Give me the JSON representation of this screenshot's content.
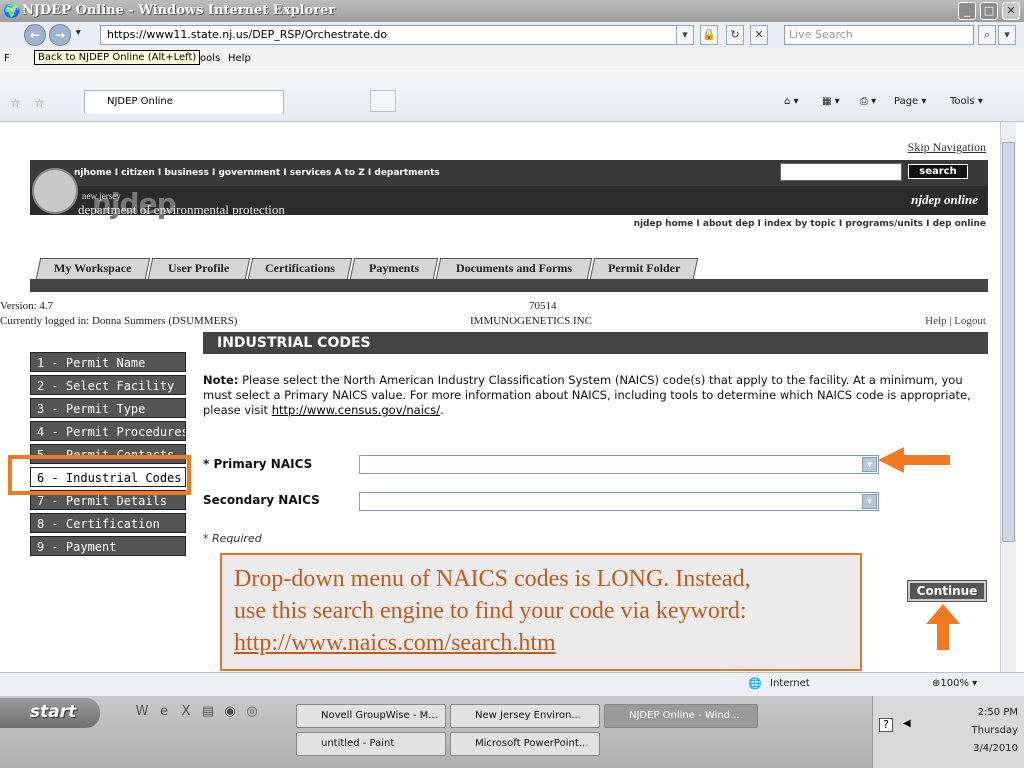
{
  "window": {
    "title": "NJDEP Online - Windows Internet Explorer",
    "controls": [
      "_",
      "□",
      "✕"
    ]
  },
  "address": {
    "url": "https://www11.state.nj.us/DEP_RSP/Orchestrate.do",
    "search_placeholder": "Live Search"
  },
  "menu": {
    "items": [
      "F",
      "ools",
      "Help"
    ],
    "tooltip": "Back to NJDEP Online (Alt+Left)"
  },
  "ie_tab": {
    "label": "NJDEP Online",
    "page_label": "Page ▾",
    "tools_label": "Tools ▾"
  },
  "site": {
    "skip_nav": "Skip Navigation",
    "top_links": "njhome  I  citizen  I  business  I  government  I  services A to Z  I  departments",
    "search_button": "search",
    "new_jersey": "new jersey",
    "nj_wordmark": "njdep",
    "department": "department of environmental protection",
    "online_logo": "njdep online",
    "sub_links": "njdep home  I  about dep  I  index by topic  I  programs/units  I  dep online"
  },
  "main_tabs": [
    "My Workspace",
    "User Profile",
    "Certifications",
    "Payments",
    "Documents and Forms",
    "Permit Folder"
  ],
  "info": {
    "version": "Version: 4.7",
    "logged_in": "Currently logged in: Donna Summers (DSUMMERS)",
    "facility_id": "70514",
    "facility_name": "IMMUNOGENETICS INC",
    "help_logout": "Help | Logout"
  },
  "sidenav": [
    "1 - Permit Name",
    "2 - Select Facility",
    "3 - Permit Type",
    "4 - Permit Procedures",
    "5 - Permit Contacts",
    "6 - Industrial Codes",
    "7 - Permit Details",
    "8 - Certification",
    "9 - Payment"
  ],
  "form": {
    "heading": "INDUSTRIAL CODES",
    "note_label": "Note:",
    "note_text": " Please select the North American Industry Classification System (NAICS) code(s) that apply to the facility. At a minimum, you must select a Primary NAICS value. For more information about NAICS, including tools to determine which NAICS code is appropriate, please visit ",
    "note_link": "http://www.census.gov/naics/",
    "note_end": ".",
    "primary_label": "* Primary NAICS",
    "secondary_label": "Secondary NAICS",
    "required_note": "* Required",
    "continue": "Continue"
  },
  "callout": {
    "line1": "Drop-down menu of NAICS codes is LONG.  Instead,",
    "line2": "use this search engine to find your code via keyword:",
    "link": "http://www.naics.com/search.htm"
  },
  "status": {
    "zone": "Internet",
    "zoom": "⊕100%  ▾"
  },
  "taskbar": {
    "start": "start",
    "buttons": [
      "Novell GroupWise - M...",
      "New Jersey Environ...",
      "NJDEP Online - Wind...",
      "untitled - Paint",
      "Microsoft PowerPoint..."
    ],
    "time": "2:50 PM",
    "day": "Thursday",
    "date": "3/4/2010"
  },
  "colors": {
    "annotation_orange": "#e8752a",
    "callout_text": "#c25a1e",
    "header_dark": "#444444"
  }
}
